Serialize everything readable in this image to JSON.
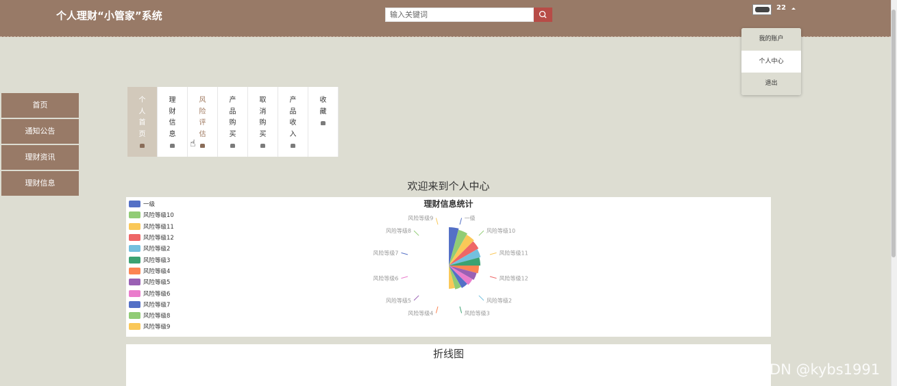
{
  "header": {
    "title": "个人理财“小管家”系统",
    "search_placeholder": "输入关键词",
    "username": "22"
  },
  "dropdown": [
    "我的账户",
    "个人中心",
    "退出"
  ],
  "sidebar": [
    "首页",
    "通知公告",
    "理财资讯",
    "理财信息"
  ],
  "tabs": [
    "个人首页",
    "理财信息",
    "风险评估",
    "产品购买",
    "取消购买",
    "产品收入",
    "收藏"
  ],
  "welcome": "欢迎来到个人中心",
  "chart_data": {
    "type": "pie",
    "title": "理财信息统计",
    "categories": [
      "一级",
      "风险等级10",
      "风险等级11",
      "风险等级12",
      "风险等级2",
      "风险等级3",
      "风险等级4",
      "风险等级5",
      "风险等级6",
      "风险等级7",
      "风险等级8",
      "风险等级9"
    ],
    "values": [
      1,
      1,
      1,
      1,
      1,
      1,
      1,
      1,
      1,
      1,
      1,
      1
    ],
    "colors": [
      "#5470c6",
      "#91cc75",
      "#fac858",
      "#ee6666",
      "#73c0de",
      "#3ba272",
      "#fc8452",
      "#9a60b4",
      "#ea7ccc",
      "#5470c6",
      "#91cc75",
      "#fac858"
    ],
    "legend_position": "top-left"
  },
  "line_chart_title": "折线图",
  "watermark": "CSDN @kybs1991"
}
